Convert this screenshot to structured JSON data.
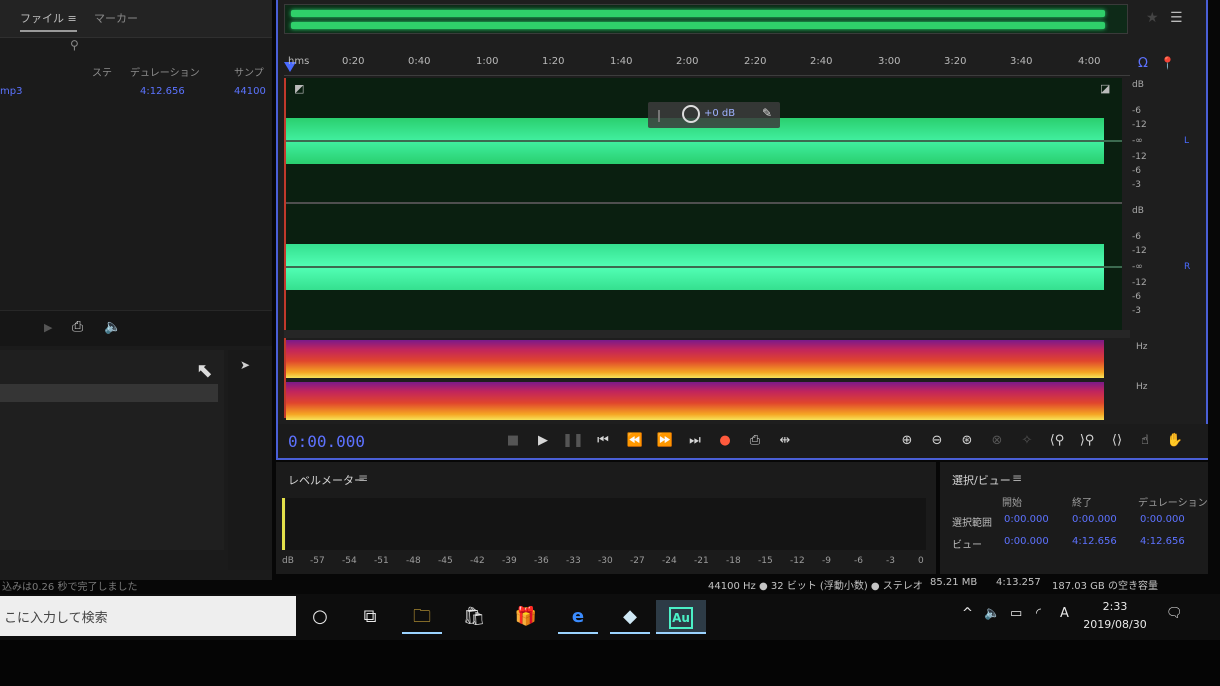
{
  "files_panel": {
    "tab_files": "ファイル ≡",
    "tab_markers": "マーカー",
    "headers": {
      "channels": "ステ",
      "duration": "デュレーション",
      "sample_rate": "サンプ"
    },
    "file": {
      "name": "mp3",
      "duration": "4:12.656",
      "sample_rate": "44100"
    },
    "status": "込みは0.26 秒で完了しました"
  },
  "editor": {
    "ruler_labels": [
      "hms",
      "0:20",
      "0:40",
      "1:00",
      "1:20",
      "1:40",
      "2:00",
      "2:20",
      "2:40",
      "3:00",
      "3:20",
      "3:40",
      "4:00"
    ],
    "hud_gain": "+0 dB",
    "db_scale": [
      "dB",
      "-6",
      "-12",
      "-∞",
      "-12",
      "-6",
      "-3",
      "dB",
      "-6",
      "-12",
      "-∞",
      "-12",
      "-6",
      "-3"
    ],
    "channel_l": "L",
    "channel_r": "R",
    "hz_label": "Hz",
    "time": "0:00.000"
  },
  "level_meter": {
    "title": "レベルメーター",
    "menu": "≡",
    "scale": [
      "dB",
      "-57",
      "-54",
      "-51",
      "-48",
      "-45",
      "-42",
      "-39",
      "-36",
      "-33",
      "-30",
      "-27",
      "-24",
      "-21",
      "-18",
      "-15",
      "-12",
      "-9",
      "-6",
      "-3",
      "0"
    ]
  },
  "selection_view": {
    "title": "選択/ビュー",
    "menu": "≡",
    "col_start": "開始",
    "col_end": "終了",
    "col_duration": "デュレーション",
    "row_selection": "選択範囲",
    "row_view": "ビュー",
    "sel_start": "0:00.000",
    "sel_end": "0:00.000",
    "sel_duration": "0:00.000",
    "view_start": "0:00.000",
    "view_end": "4:12.656",
    "view_duration": "4:12.656"
  },
  "status_bar": {
    "format": "44100 Hz ● 32 ビット (浮動小数) ● ステレオ",
    "size": "85.21 MB",
    "length": "4:13.257",
    "free": "187.03 GB の空き容量"
  },
  "taskbar": {
    "search_placeholder": "こに入力して検索",
    "ime": "A",
    "time": "2:33",
    "date": "2019/08/30",
    "app_label": "Au"
  },
  "colors": {
    "accent": "#5d72ff",
    "waveform": "#3be38c",
    "record": "#ff5a3d"
  }
}
